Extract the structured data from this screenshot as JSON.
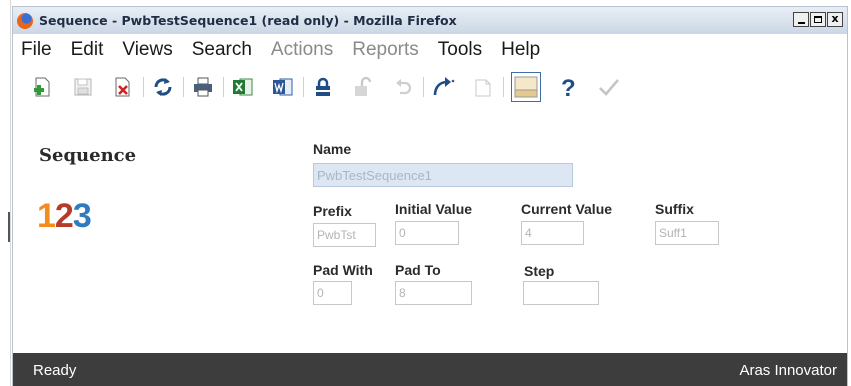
{
  "window": {
    "title": "Sequence - PwbTestSequence1 (read only) - Mozilla Firefox",
    "buttons": {
      "minimize": "_",
      "maximize": "□",
      "close": "x"
    }
  },
  "menu": [
    {
      "label": "File",
      "enabled": true
    },
    {
      "label": "Edit",
      "enabled": true
    },
    {
      "label": "Views",
      "enabled": true
    },
    {
      "label": "Search",
      "enabled": true
    },
    {
      "label": "Actions",
      "enabled": false
    },
    {
      "label": "Reports",
      "enabled": false
    },
    {
      "label": "Tools",
      "enabled": true
    },
    {
      "label": "Help",
      "enabled": true
    }
  ],
  "toolbar": [
    "new-item-icon",
    "save-icon",
    "delete-icon",
    "refresh-icon",
    "print-icon",
    "excel-icon",
    "word-icon",
    "lock-icon",
    "unlock-icon",
    "undo-icon",
    "redo-icon",
    "new-document-icon",
    "layout-toggle-icon",
    "help-icon",
    "check-icon"
  ],
  "form": {
    "heading": "Sequence",
    "logo": {
      "d1": "1",
      "d2": "2",
      "d3": "3"
    },
    "labels": {
      "name": "Name",
      "prefix": "Prefix",
      "initial_value": "Initial Value",
      "current_value": "Current Value",
      "suffix": "Suffix",
      "pad_with": "Pad With",
      "pad_to": "Pad To",
      "step": "Step"
    },
    "values": {
      "name": "PwbTestSequence1",
      "prefix": "PwbTst",
      "initial_value": "0",
      "current_value": "4",
      "suffix": "Suff1",
      "pad_with": "0",
      "pad_to": "8",
      "step": ""
    }
  },
  "status": {
    "left": "Ready",
    "right": "Aras Innovator"
  },
  "colors": {
    "statusbar": "#3d3d3d",
    "name_field": "#dde7f3",
    "logo_1": "#f28c1c",
    "logo_2": "#b73a2a",
    "logo_3": "#2e7bbf"
  }
}
